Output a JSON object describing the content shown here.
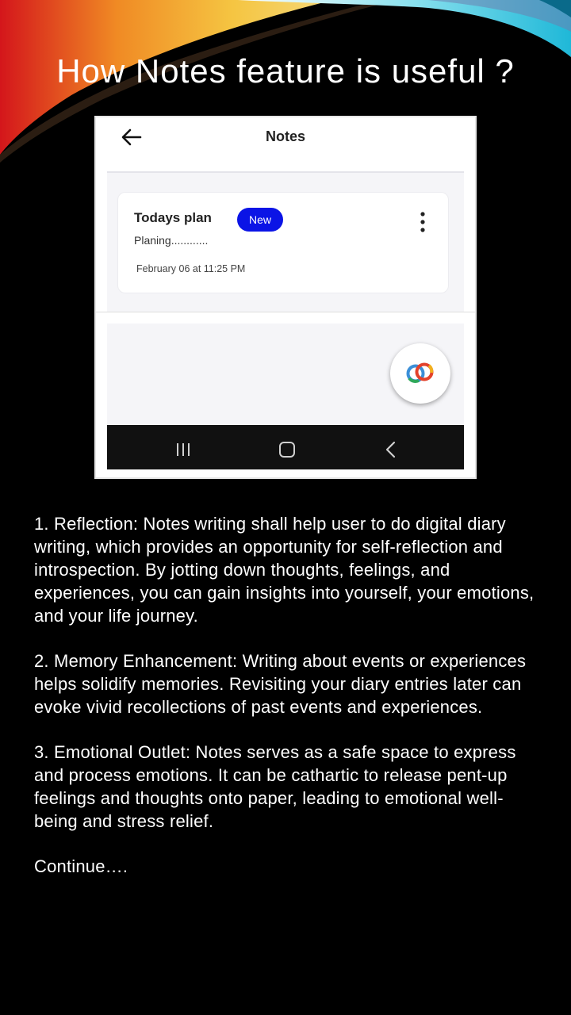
{
  "slide": {
    "title": "How Notes feature is useful ?",
    "colors": {
      "background": "#000000",
      "badge": "#0b14e6",
      "swoosh_orange": "#f08a24",
      "swoosh_red": "#d4161b",
      "swoosh_cyan": "#1fb8d8"
    }
  },
  "phone": {
    "appbar": {
      "title": "Notes",
      "back_icon": "arrow-left-icon"
    },
    "note": {
      "title": "Todays plan",
      "badge": "New",
      "body": "Planing............",
      "date": "February 06 at 11:25 PM",
      "menu_icon": "more-vertical-icon"
    },
    "fab_icon": "linked-rings-icon",
    "navbar": {
      "icons": [
        "recents-icon",
        "home-icon",
        "back-icon"
      ]
    }
  },
  "content": {
    "paragraphs": [
      "1. Reflection: Notes writing shall help user to do digital diary writing, which provides an opportunity for self-reflection and introspection. By jotting down thoughts, feelings, and experiences, you can gain insights into yourself, your emotions, and your life journey.",
      "2. Memory Enhancement: Writing about events or experiences helps solidify memories. Revisiting your diary entries later can evoke vivid recollections of past events and experiences.",
      "3. Emotional Outlet: Notes serves as a safe space to express and process emotions. It can be cathartic to release pent-up feelings and thoughts onto paper, leading to emotional well-being and stress relief."
    ],
    "continue": "Continue…."
  }
}
